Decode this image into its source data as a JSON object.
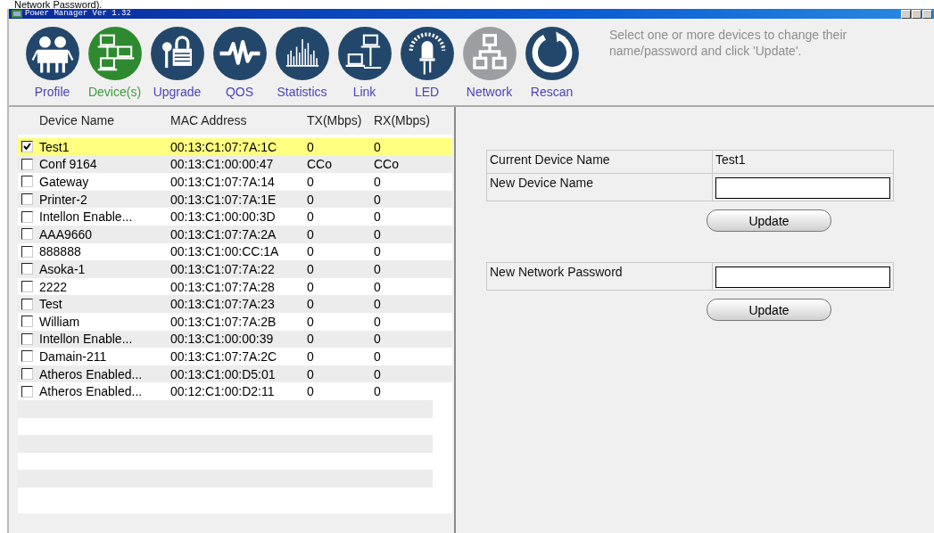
{
  "caption": "Network Password).",
  "window": {
    "title": "Power Manager Ver 1.32"
  },
  "toolbar": [
    {
      "label": "Profile",
      "selected": false,
      "disabled": false
    },
    {
      "label": "Device(s)",
      "selected": true,
      "disabled": false
    },
    {
      "label": "Upgrade",
      "selected": false,
      "disabled": false
    },
    {
      "label": "QOS",
      "selected": false,
      "disabled": false
    },
    {
      "label": "Statistics",
      "selected": false,
      "disabled": false
    },
    {
      "label": "Link",
      "selected": false,
      "disabled": false
    },
    {
      "label": "LED",
      "selected": false,
      "disabled": false
    },
    {
      "label": "Network",
      "selected": false,
      "disabled": true
    },
    {
      "label": "Rescan",
      "selected": false,
      "disabled": false
    }
  ],
  "help_text": "Select one or more devices to change their name/password and click 'Update'.",
  "table": {
    "columns": [
      "Device Name",
      "MAC Address",
      "TX(Mbps)",
      "RX(Mbps)"
    ],
    "rows": [
      {
        "name": "Test1",
        "mac": "00:13:C1:07:7A:1C",
        "tx": "0",
        "rx": "0",
        "checked": true,
        "selected": true
      },
      {
        "name": "Conf 9164",
        "mac": "00:13:C1:00:00:47",
        "tx": "CCo",
        "rx": "CCo",
        "checked": false,
        "selected": false
      },
      {
        "name": "Gateway",
        "mac": "00:13:C1:07:7A:14",
        "tx": "0",
        "rx": "0",
        "checked": false,
        "selected": false
      },
      {
        "name": "Printer-2",
        "mac": "00:13:C1:07:7A:1E",
        "tx": "0",
        "rx": "0",
        "checked": false,
        "selected": false
      },
      {
        "name": "Intellon Enable...",
        "mac": "00:13:C1:00:00:3D",
        "tx": "0",
        "rx": "0",
        "checked": false,
        "selected": false
      },
      {
        "name": "AAA9660",
        "mac": "00:13:C1:07:7A:2A",
        "tx": "0",
        "rx": "0",
        "checked": false,
        "selected": false
      },
      {
        "name": "888888",
        "mac": "00:13:C1:00:CC:1A",
        "tx": "0",
        "rx": "0",
        "checked": false,
        "selected": false
      },
      {
        "name": "Asoka-1",
        "mac": "00:13:C1:07:7A:22",
        "tx": "0",
        "rx": "0",
        "checked": false,
        "selected": false
      },
      {
        "name": "2222",
        "mac": "00:13:C1:07:7A:28",
        "tx": "0",
        "rx": "0",
        "checked": false,
        "selected": false
      },
      {
        "name": "Test",
        "mac": "00:13:C1:07:7A:23",
        "tx": "0",
        "rx": "0",
        "checked": false,
        "selected": false
      },
      {
        "name": "William",
        "mac": "00:13:C1:07:7A:2B",
        "tx": "0",
        "rx": "0",
        "checked": false,
        "selected": false
      },
      {
        "name": "Intellon Enable...",
        "mac": "00:13:C1:00:00:39",
        "tx": "0",
        "rx": "0",
        "checked": false,
        "selected": false
      },
      {
        "name": "Damain-211",
        "mac": "00:13:C1:07:7A:2C",
        "tx": "0",
        "rx": "0",
        "checked": false,
        "selected": false
      },
      {
        "name": "Atheros Enabled...",
        "mac": "00:13:C1:00:D5:01",
        "tx": "0",
        "rx": "0",
        "checked": false,
        "selected": false
      },
      {
        "name": "Atheros Enabled...",
        "mac": "00:12:C1:00:D2:11",
        "tx": "0",
        "rx": "0",
        "checked": false,
        "selected": false
      }
    ]
  },
  "name_form": {
    "current_label": "Current Device Name",
    "current_value": "Test1",
    "new_label": "New Device Name",
    "button": "Update"
  },
  "password_form": {
    "label": "New Network Password",
    "button": "Update"
  }
}
